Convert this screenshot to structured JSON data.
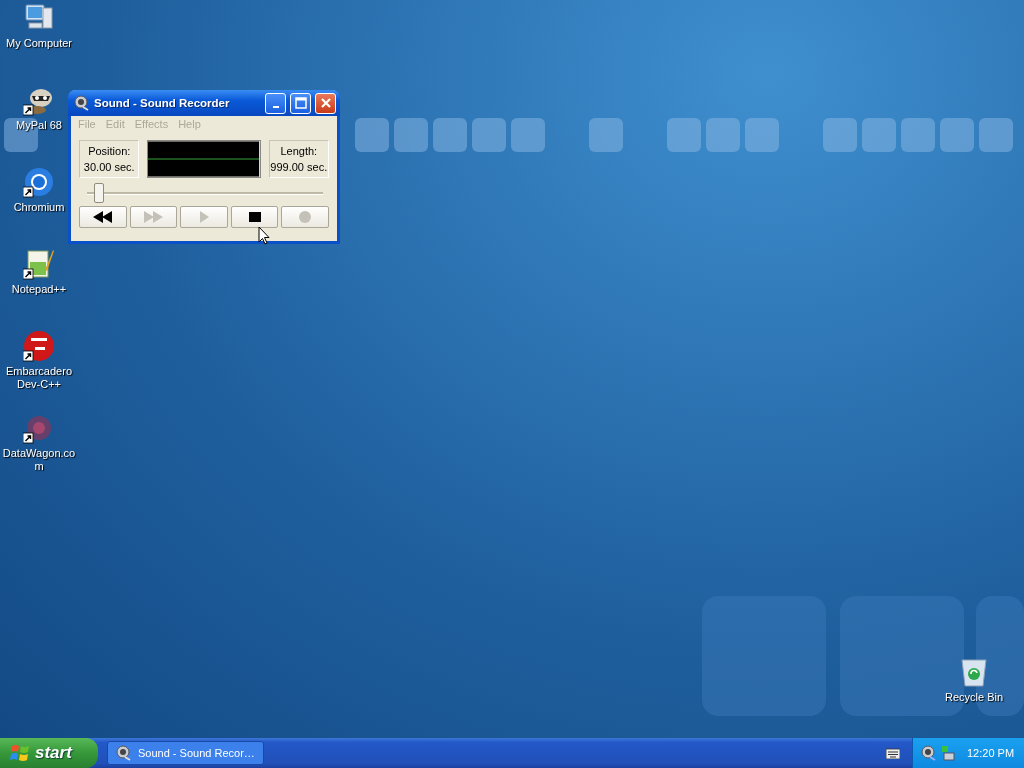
{
  "desktop_icons": [
    {
      "kind": "computer",
      "label": "My Computer",
      "shortcut": false
    },
    {
      "kind": "raccoon",
      "label": "MyPal 68",
      "shortcut": true
    },
    {
      "kind": "chromium",
      "label": "Chromium",
      "shortcut": true
    },
    {
      "kind": "notepad",
      "label": "Notepad++",
      "shortcut": true
    },
    {
      "kind": "devcpp",
      "label": "Embarcadero Dev-C++",
      "shortcut": true
    },
    {
      "kind": "datawagon",
      "label": "DataWagon.co m",
      "shortcut": true
    }
  ],
  "recycle_bin": {
    "label": "Recycle Bin"
  },
  "window": {
    "title": "Sound - Sound Recorder",
    "menu": [
      {
        "label": "File",
        "disabled": true
      },
      {
        "label": "Edit",
        "disabled": true
      },
      {
        "label": "Effects",
        "disabled": true
      },
      {
        "label": "Help",
        "disabled": true
      }
    ],
    "position_label": "Position:",
    "position": "30.00 sec.",
    "length_label": "Length:",
    "length": "999.00 sec.",
    "slider": {
      "level": 0.03
    },
    "buttons": [
      {
        "kind": "rewind",
        "disabled": false
      },
      {
        "kind": "forward",
        "disabled": true
      },
      {
        "kind": "play",
        "disabled": true
      },
      {
        "kind": "stop",
        "disabled": false
      },
      {
        "kind": "record",
        "disabled": true
      }
    ]
  },
  "taskbar": {
    "start": "start",
    "tasks": [
      {
        "label": "Sound - Sound Recor…",
        "selected": false
      }
    ],
    "clock": "12:20 PM"
  }
}
